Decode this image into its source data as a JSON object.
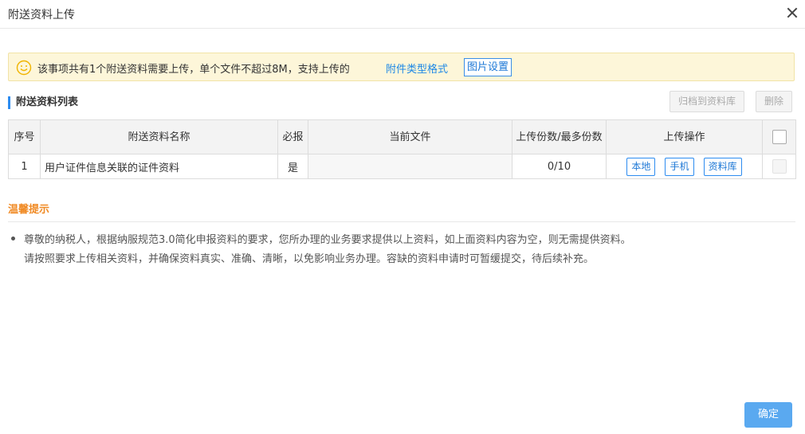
{
  "dialog": {
    "title": "附送资料上传"
  },
  "notice": {
    "text": "该事项共有1个附送资料需要上传，单个文件不超过8M，支持上传的",
    "link": "附件类型格式",
    "image_settings_label": "图片设置"
  },
  "section": {
    "title": "附送资料列表",
    "archive_label": "归档到资料库",
    "delete_label": "删除"
  },
  "table": {
    "headers": {
      "index": "序号",
      "name": "附送资料名称",
      "required": "必报",
      "current_file": "当前文件",
      "count": "上传份数/最多份数",
      "operations": "上传操作"
    },
    "rows": [
      {
        "index": "1",
        "name": "用户证件信息关联的证件资料",
        "required": "是",
        "current_file": "",
        "count": "0/10",
        "ops": [
          "本地",
          "手机",
          "资料库"
        ]
      }
    ]
  },
  "tips": {
    "title": "温馨提示",
    "line1": "尊敬的纳税人，根据纳服规范3.0简化申报资料的要求，您所办理的业务要求提供以上资料，如上面资料内容为空，则无需提供资料。",
    "line2": "请按照要求上传相关资料，并确保资料真实、准确、清晰，以免影响业务办理。容缺的资料申请时可暂缓提交，待后续补充。"
  },
  "footer": {
    "confirm_label": "确定"
  },
  "colors": {
    "accent": "#2d8cf0",
    "notice_bg": "#fdf6d9",
    "tips_title": "#f08a24",
    "confirm_bg": "#5aa9f0"
  }
}
